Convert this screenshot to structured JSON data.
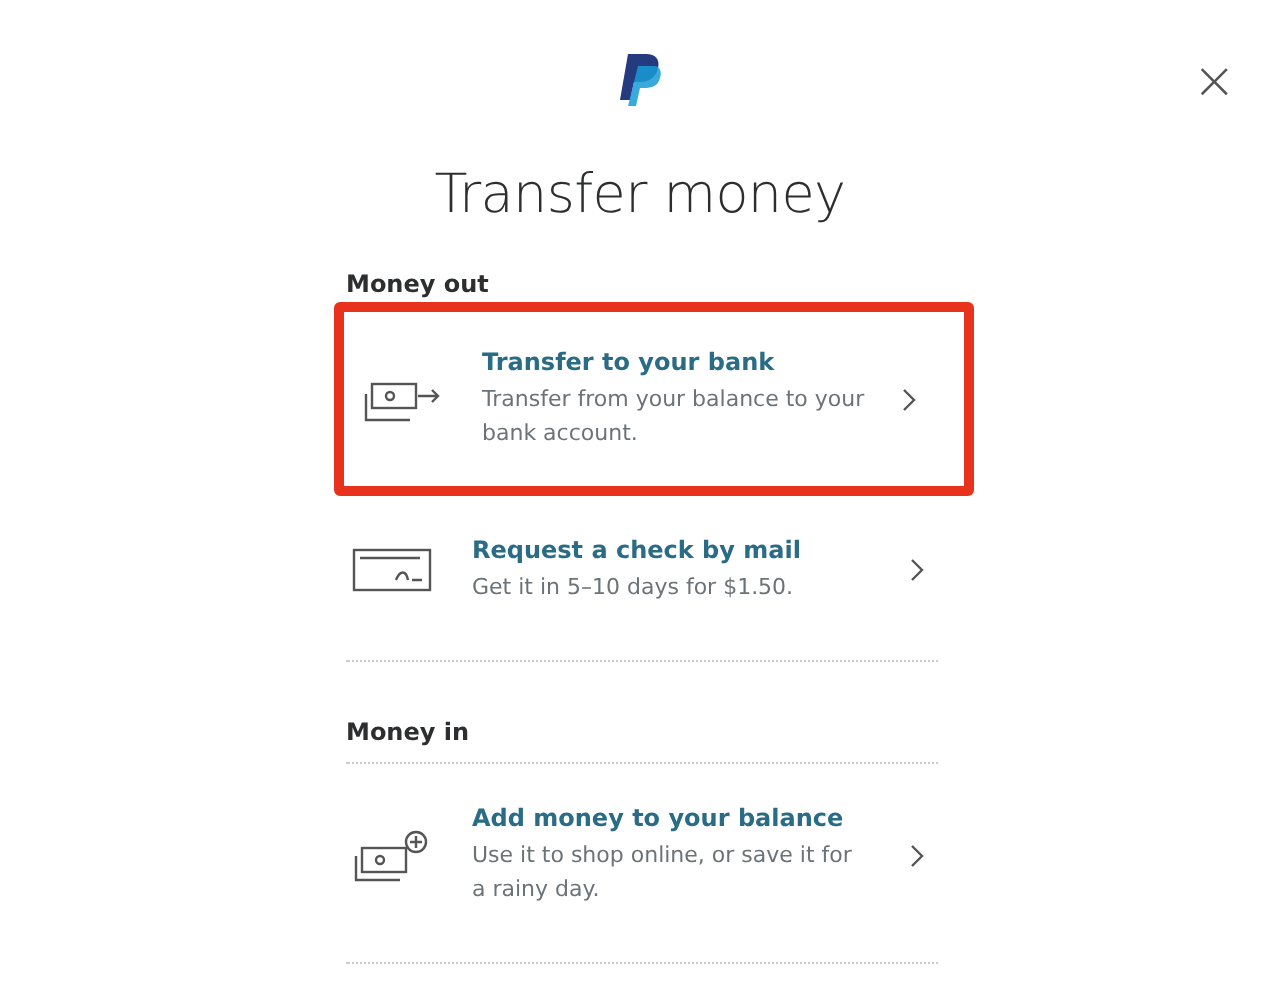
{
  "dialog": {
    "close_label": "×",
    "title": "Transfer money"
  },
  "sections": [
    {
      "heading": "Money out",
      "items": [
        {
          "kind": "bank",
          "title": "Transfer to your bank",
          "description": "Transfer from your balance to your bank account.",
          "highlighted": true
        },
        {
          "kind": "check",
          "title": "Request a check by mail",
          "description": "Get it in 5–10 days for $1.50.",
          "highlighted": false
        }
      ]
    },
    {
      "heading": "Money in",
      "items": [
        {
          "kind": "add",
          "title": "Add money to your balance",
          "description": "Use it to shop online, or save it for a rainy day.",
          "highlighted": false
        }
      ]
    }
  ]
}
